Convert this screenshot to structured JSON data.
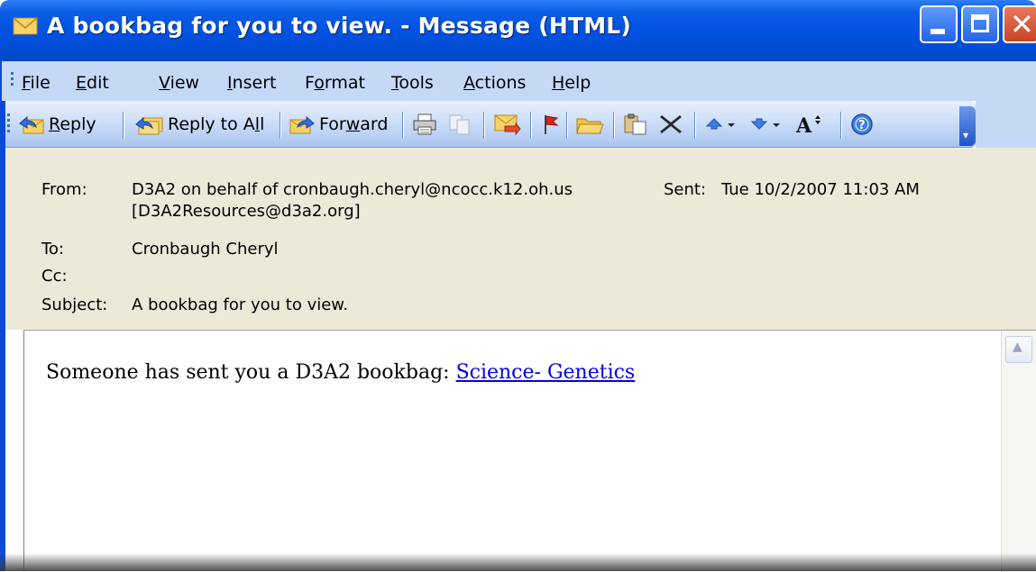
{
  "window": {
    "title": "A bookbag for you to view. - Message (HTML)"
  },
  "menu": [
    {
      "label": "File",
      "u": "F",
      "rest": "ile"
    },
    {
      "label": "Edit",
      "u": "E",
      "rest": "dit"
    },
    {
      "label": "View",
      "u": "V",
      "rest": "iew"
    },
    {
      "label": "Insert",
      "u": "I",
      "rest": "nsert"
    },
    {
      "label": "Format",
      "pre": "F",
      "u": "o",
      "rest": "rmat"
    },
    {
      "label": "Tools",
      "u": "T",
      "rest": "ools"
    },
    {
      "label": "Actions",
      "u": "A",
      "rest": "ctions"
    },
    {
      "label": "Help",
      "u": "H",
      "rest": "elp"
    }
  ],
  "toolbar": {
    "reply": {
      "u": "R",
      "rest": "eply"
    },
    "reply_all": {
      "pre": "Reply to A",
      "u": "l",
      "rest": "l"
    },
    "forward": {
      "pre": "For",
      "u": "w",
      "rest": "ard"
    }
  },
  "header": {
    "from_label": "From:",
    "from_value_line1": "D3A2 on behalf of cronbaugh.cheryl@ncocc.k12.oh.us",
    "from_value_line2": "[D3A2Resources@d3a2.org]",
    "sent_label": "Sent:",
    "sent_value": "Tue 10/2/2007 11:03 AM",
    "to_label": "To:",
    "to_value": "Cronbaugh Cheryl",
    "cc_label": "Cc:",
    "cc_value": "",
    "subject_label": "Subject:",
    "subject_value": "A bookbag for you to view."
  },
  "body": {
    "text": "Someone has sent you a D3A2 bookbag: ",
    "link": "Science- Genetics"
  },
  "colors": {
    "titlebar": "#0251e0",
    "menubar": "#c5d9f7",
    "header_bg": "#ece9d8",
    "link": "#0000ee"
  }
}
